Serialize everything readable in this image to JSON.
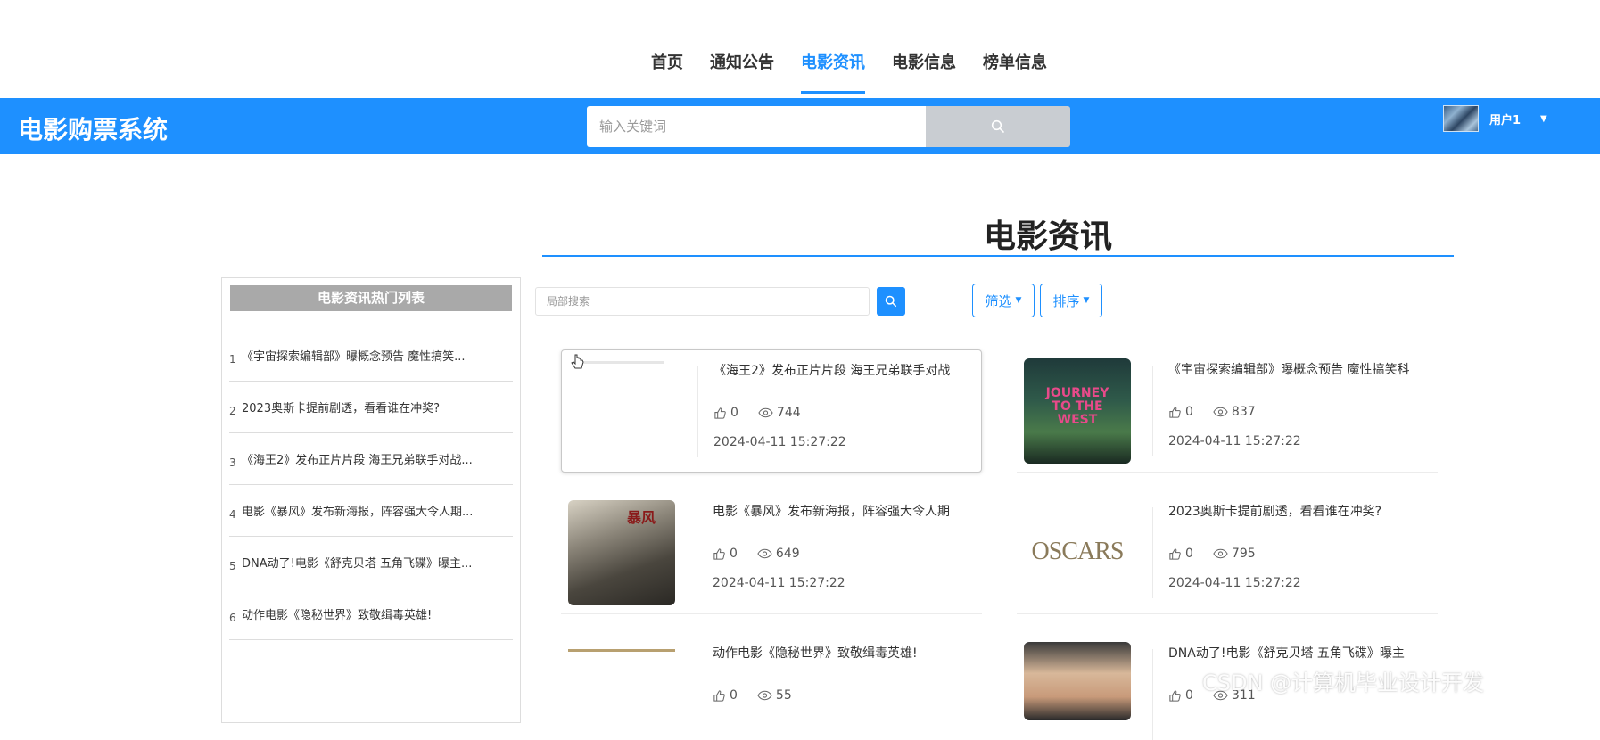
{
  "nav": {
    "items": [
      {
        "label": "首页",
        "active": false
      },
      {
        "label": "通知公告",
        "active": false
      },
      {
        "label": "电影资讯",
        "active": true
      },
      {
        "label": "电影信息",
        "active": false
      },
      {
        "label": "榜单信息",
        "active": false
      }
    ]
  },
  "header": {
    "title": "电影购票系统",
    "search_placeholder": "输入关键词",
    "user_name": "用户1"
  },
  "page": {
    "title": "电影资讯"
  },
  "hot": {
    "title": "电影资讯热门列表",
    "items": [
      {
        "num": "1",
        "text": "《宇宙探索编辑部》曝概念预告 魔性搞笑..."
      },
      {
        "num": "2",
        "text": "2023奥斯卡提前剧透，看看谁在冲奖?"
      },
      {
        "num": "3",
        "text": "《海王2》发布正片片段 海王兄弟联手对战..."
      },
      {
        "num": "4",
        "text": "电影《暴风》发布新海报，阵容强大令人期..."
      },
      {
        "num": "5",
        "text": "DNA动了!电影《舒克贝塔 五角飞碟》曝主..."
      },
      {
        "num": "6",
        "text": "动作电影《隐秘世界》致敬缉毒英雄!"
      }
    ]
  },
  "toolbar": {
    "local_search_placeholder": "局部搜索",
    "filter_label": "筛选",
    "sort_label": "排序"
  },
  "cards": [
    {
      "title": "《海王2》发布正片片段 海王兄弟联手对战",
      "likes": "0",
      "views": "744",
      "date": "2024-04-11 15:27:22",
      "thumb_text": ""
    },
    {
      "title": "《宇宙探索编辑部》曝概念预告 魔性搞笑科",
      "likes": "0",
      "views": "837",
      "date": "2024-04-11 15:27:22",
      "thumb_text": "JOURNEY TO THE WEST"
    },
    {
      "title": "电影《暴风》发布新海报，阵容强大令人期",
      "likes": "0",
      "views": "649",
      "date": "2024-04-11 15:27:22",
      "thumb_text": "暴风"
    },
    {
      "title": "2023奥斯卡提前剧透，看看谁在冲奖?",
      "likes": "0",
      "views": "795",
      "date": "2024-04-11 15:27:22",
      "thumb_text": "OSCARS"
    },
    {
      "title": "动作电影《隐秘世界》致敬缉毒英雄!",
      "likes": "0",
      "views": "55",
      "date": "",
      "thumb_text": ""
    },
    {
      "title": "DNA动了!电影《舒克贝塔 五角飞碟》曝主",
      "likes": "0",
      "views": "311",
      "date": "",
      "thumb_text": ""
    }
  ],
  "watermark": "CSDN @计算机毕业设计开发",
  "colors": {
    "primary": "#1e90ff",
    "search_button": "#c9cdd2",
    "hot_header": "#a9a9a9"
  }
}
